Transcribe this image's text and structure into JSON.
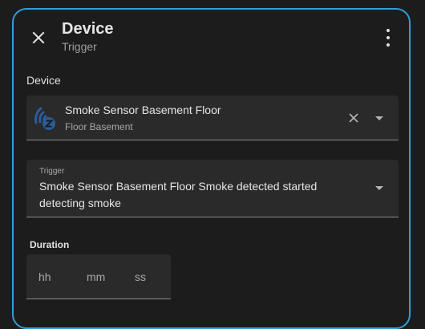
{
  "dialog": {
    "title": "Device",
    "subtitle": "Trigger",
    "close_icon": "close-icon",
    "more_icon": "more-vertical-icon"
  },
  "device_section": {
    "label": "Device",
    "name": "Smoke Sensor Basement Floor",
    "area": "Floor Basement",
    "device_icon": "zwave-device-icon",
    "clear_icon": "close-icon",
    "dropdown_icon": "chevron-down-icon"
  },
  "trigger_field": {
    "label": "Trigger",
    "value": "Smoke Sensor Basement Floor Smoke detected started detecting smoke",
    "dropdown_icon": "chevron-down-icon"
  },
  "duration": {
    "label": "Duration",
    "hours_placeholder": "hh",
    "minutes_placeholder": "mm",
    "seconds_placeholder": "ss"
  },
  "colors": {
    "accent_border": "#2f9fd7",
    "background": "#1c1c1c",
    "field_background": "#2a2a2a",
    "device_icon": "#2b5c99"
  }
}
